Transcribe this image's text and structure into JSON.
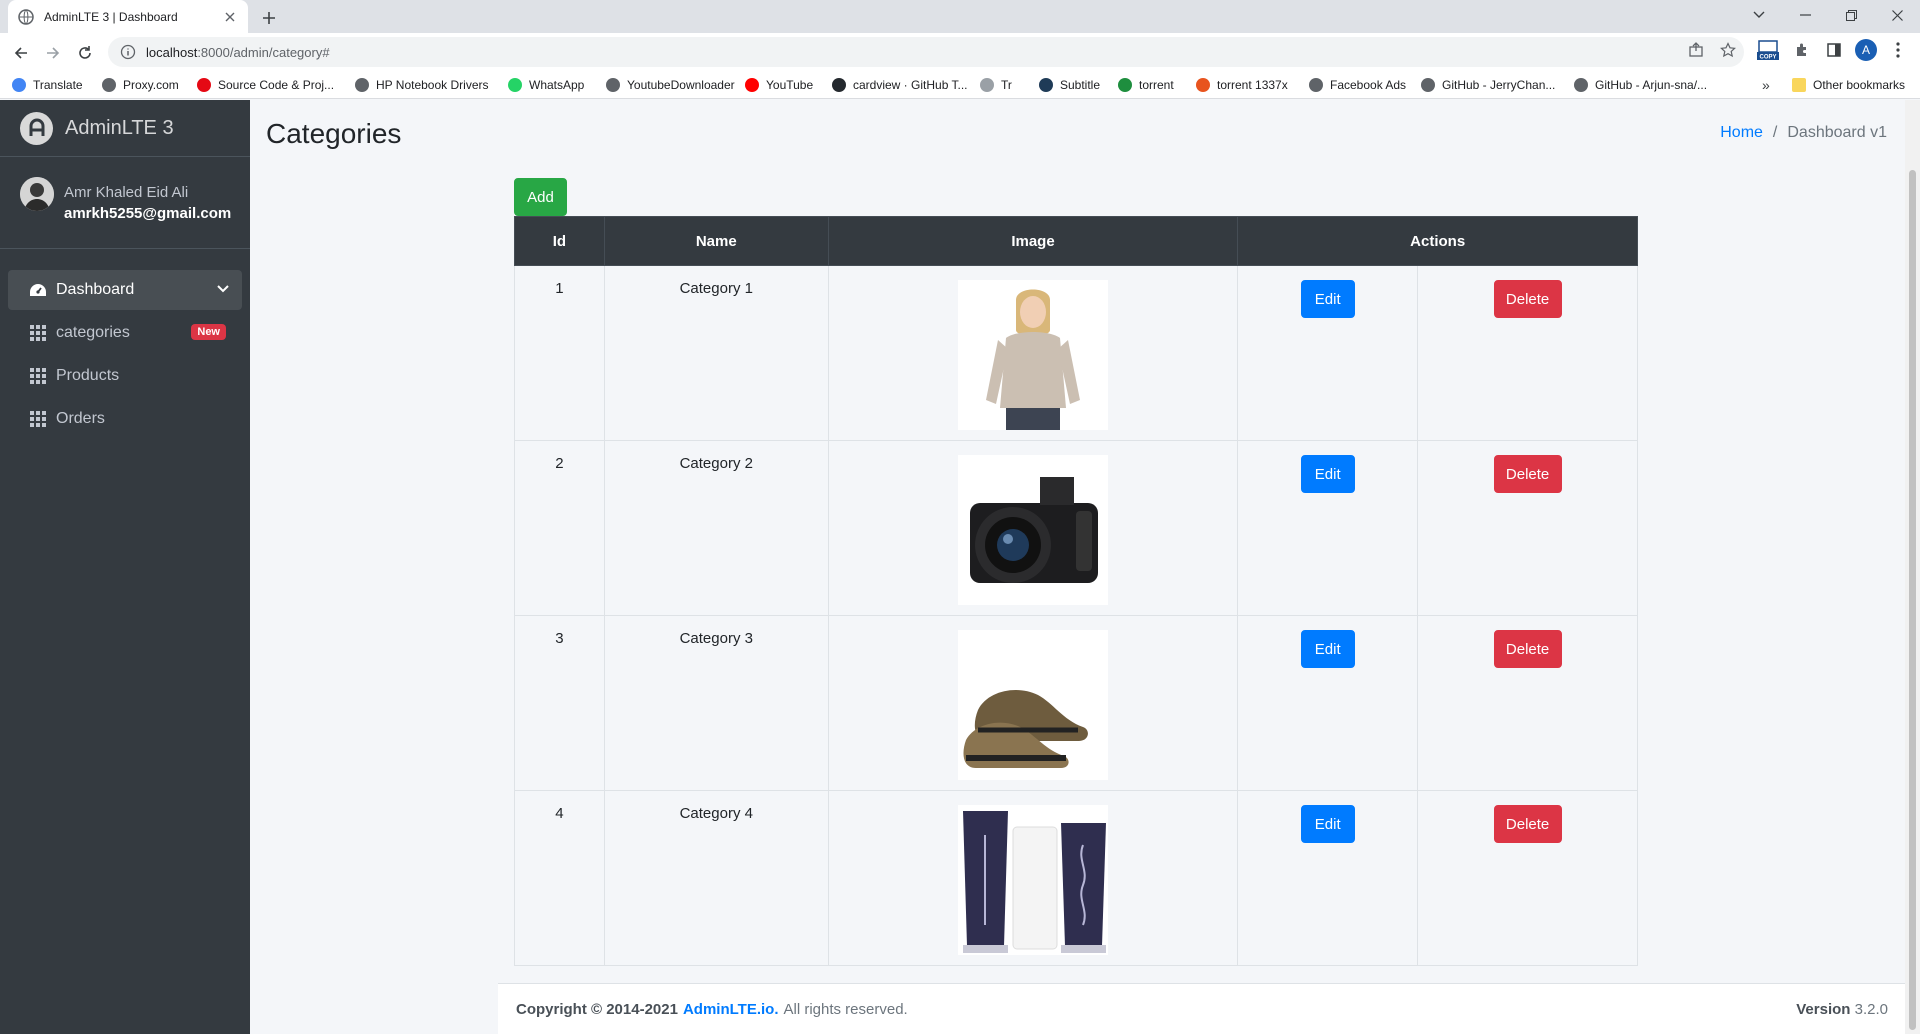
{
  "browser": {
    "tab_title": "AdminLTE 3 | Dashboard",
    "url_host": "localhost",
    "url_path": ":8000/admin/category#",
    "bookmarks": [
      {
        "label": "Translate",
        "color": "#4285f4"
      },
      {
        "label": "Proxy.com",
        "color": "#5f6368"
      },
      {
        "label": "Source Code & Proj...",
        "color": "#e50914"
      },
      {
        "label": "HP Notebook Drivers",
        "color": "#5f6368"
      },
      {
        "label": "WhatsApp",
        "color": "#25d366"
      },
      {
        "label": "YoutubeDownloader",
        "color": "#5f6368"
      },
      {
        "label": "YouTube",
        "color": "#ff0000"
      },
      {
        "label": "cardview · GitHub T...",
        "color": "#24292e"
      },
      {
        "label": "Tr",
        "color": "#9aa0a6"
      },
      {
        "label": "Subtitle",
        "color": "#1f3b57"
      },
      {
        "label": "torrent",
        "color": "#1e8e3e"
      },
      {
        "label": "torrent 1337x",
        "color": "#e8541e"
      },
      {
        "label": "Facebook Ads",
        "color": "#5f6368"
      },
      {
        "label": "GitHub - JerryChan...",
        "color": "#5f6368"
      },
      {
        "label": "GitHub - Arjun-sna/...",
        "color": "#5f6368"
      }
    ],
    "other_bookmarks": "Other bookmarks",
    "profile_initial": "A"
  },
  "sidebar": {
    "brand": "AdminLTE 3",
    "user_name": "Amr Khaled Eid Ali",
    "user_email": "amrkh5255@gmail.com",
    "items": [
      {
        "label": "Dashboard",
        "icon": "tachometer-icon",
        "active": true
      },
      {
        "label": "categories",
        "icon": "grid-icon",
        "badge": "New"
      },
      {
        "label": "Products",
        "icon": "grid-icon"
      },
      {
        "label": "Orders",
        "icon": "grid-icon"
      }
    ]
  },
  "header": {
    "title": "Categories",
    "breadcrumb_home": "Home",
    "breadcrumb_current": "Dashboard v1"
  },
  "actions": {
    "add_label": "Add"
  },
  "table": {
    "columns": [
      "Id",
      "Name",
      "Image",
      "Actions"
    ],
    "edit_label": "Edit",
    "delete_label": "Delete",
    "rows": [
      {
        "id": "1",
        "name": "Category 1",
        "image": "woman-sweater-image"
      },
      {
        "id": "2",
        "name": "Category 2",
        "image": "camera-image"
      },
      {
        "id": "3",
        "name": "Category 3",
        "image": "shoes-image"
      },
      {
        "id": "4",
        "name": "Category 4",
        "image": "skincare-tubes-image"
      }
    ]
  },
  "footer": {
    "copyright": "Copyright © 2014-2021",
    "link": "AdminLTE.io.",
    "rights": "All rights reserved.",
    "version_label": "Version",
    "version_value": "3.2.0"
  },
  "colors": {
    "sidebar_bg": "#343a40",
    "primary": "#007bff",
    "success": "#28a745",
    "danger": "#dc3545"
  }
}
